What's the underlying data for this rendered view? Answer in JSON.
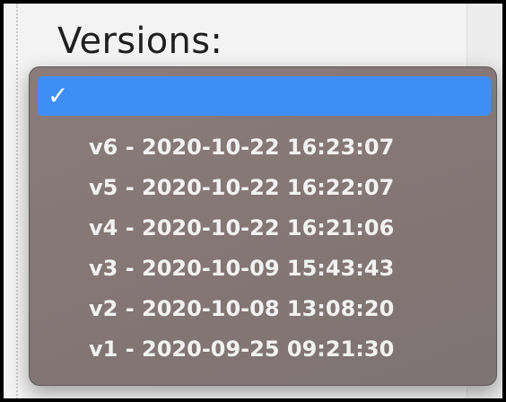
{
  "field": {
    "label": "Versions:"
  },
  "dropdown": {
    "selected_index": 0,
    "check_glyph": "✓",
    "options": [
      "",
      "v6 - 2020-10-22 16:23:07",
      "v5 - 2020-10-22 16:22:07",
      "v4 - 2020-10-22 16:21:06",
      "v3 - 2020-10-09 15:43:43",
      "v2 - 2020-10-08 13:08:20",
      "v1 - 2020-09-25 09:21:30"
    ]
  },
  "colors": {
    "selection": "#3f8ef6",
    "menu_background": "#857776",
    "menu_text": "#f2f2f2",
    "frame_border": "#000000"
  },
  "icons": {
    "selected_marker": "checkmark-icon"
  }
}
